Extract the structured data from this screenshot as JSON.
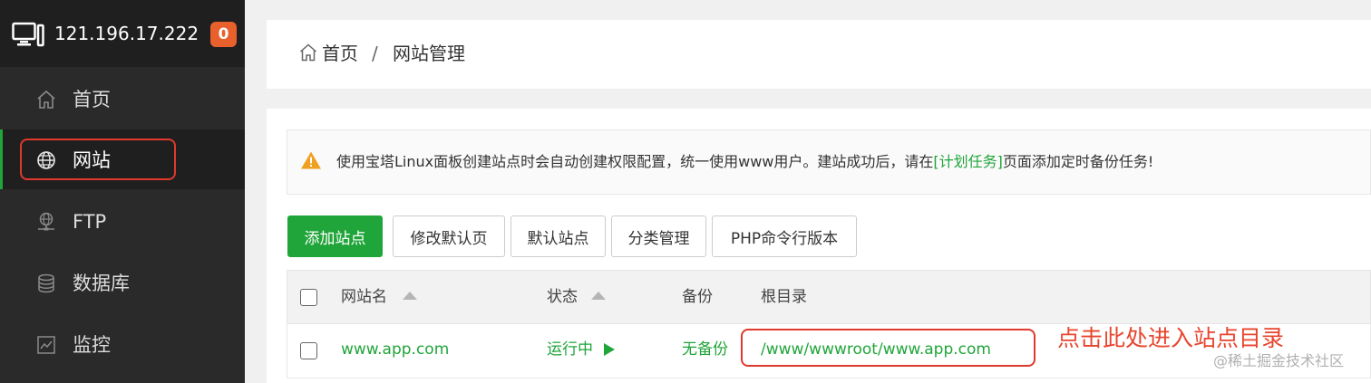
{
  "server": {
    "ip": "121.196.17.222",
    "badge": "0"
  },
  "sidebar": {
    "items": [
      {
        "label": "首页",
        "icon": "home-icon"
      },
      {
        "label": "网站",
        "icon": "globe-icon",
        "active": true
      },
      {
        "label": "FTP",
        "icon": "ftp-icon"
      },
      {
        "label": "数据库",
        "icon": "database-icon"
      },
      {
        "label": "监控",
        "icon": "monitor-icon"
      }
    ]
  },
  "breadcrumb": {
    "home": "首页",
    "separator": "/",
    "current": "网站管理"
  },
  "notice": {
    "text_before": "使用宝塔Linux面板创建站点时会自动创建权限配置，统一使用www用户。建站成功后，请在",
    "link": "[计划任务]",
    "text_after": "页面添加定时备份任务!"
  },
  "toolbar": {
    "add_site": "添加站点",
    "edit_default_page": "修改默认页",
    "default_site": "默认站点",
    "category_manage": "分类管理",
    "php_cli_version": "PHP命令行版本"
  },
  "table": {
    "headers": {
      "name": "网站名",
      "status": "状态",
      "backup": "备份",
      "root": "根目录"
    },
    "rows": [
      {
        "name": "www.app.com",
        "status": "运行中",
        "backup": "无备份",
        "root": "/www/wwwroot/www.app.com"
      }
    ]
  },
  "annotation": "点击此处进入站点目录",
  "watermark": "@稀土掘金技术社区",
  "colors": {
    "accent": "#20a53a",
    "badge": "#e8612c",
    "annotation_red": "#e0392b",
    "sidebar_bg": "#2a2a2a"
  }
}
